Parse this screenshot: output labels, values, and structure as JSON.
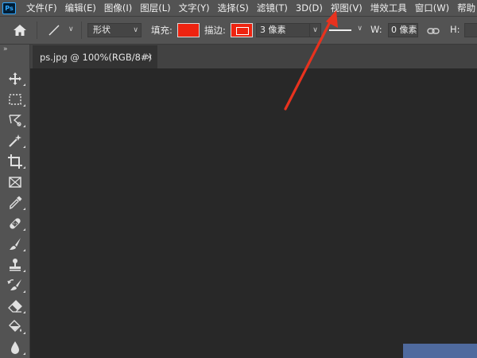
{
  "app": {
    "logo_text": "Ps"
  },
  "menubar": {
    "items": [
      "文件(F)",
      "编辑(E)",
      "图像(I)",
      "图层(L)",
      "文字(Y)",
      "选择(S)",
      "滤镜(T)",
      "3D(D)",
      "视图(V)",
      "增效工具",
      "窗口(W)",
      "帮助"
    ]
  },
  "options_bar": {
    "mode_value": "形状",
    "fill_label": "填充:",
    "fill_color": "#ee2310",
    "stroke_label": "描边:",
    "stroke_color": "#ee2310",
    "stroke_width_value": "3 像素",
    "w_label": "W:",
    "w_value": "0 像素",
    "h_label": "H:"
  },
  "document_tab": {
    "title": "ps.jpg @ 100%(RGB/8#)",
    "close_symbol": "×"
  },
  "toolbar": {
    "collapse_symbol": "»",
    "tools": [
      "move-tool",
      "marquee-tool",
      "lasso-tool",
      "magic-wand-tool",
      "crop-tool",
      "frame-tool",
      "eyedropper-tool",
      "healing-brush-tool",
      "brush-tool",
      "clone-stamp-tool",
      "history-brush-tool",
      "eraser-tool",
      "paint-bucket-tool",
      "blur-tool"
    ]
  },
  "annotation": {
    "arrow_color": "#e8321e",
    "points_to": "视图(V)"
  }
}
